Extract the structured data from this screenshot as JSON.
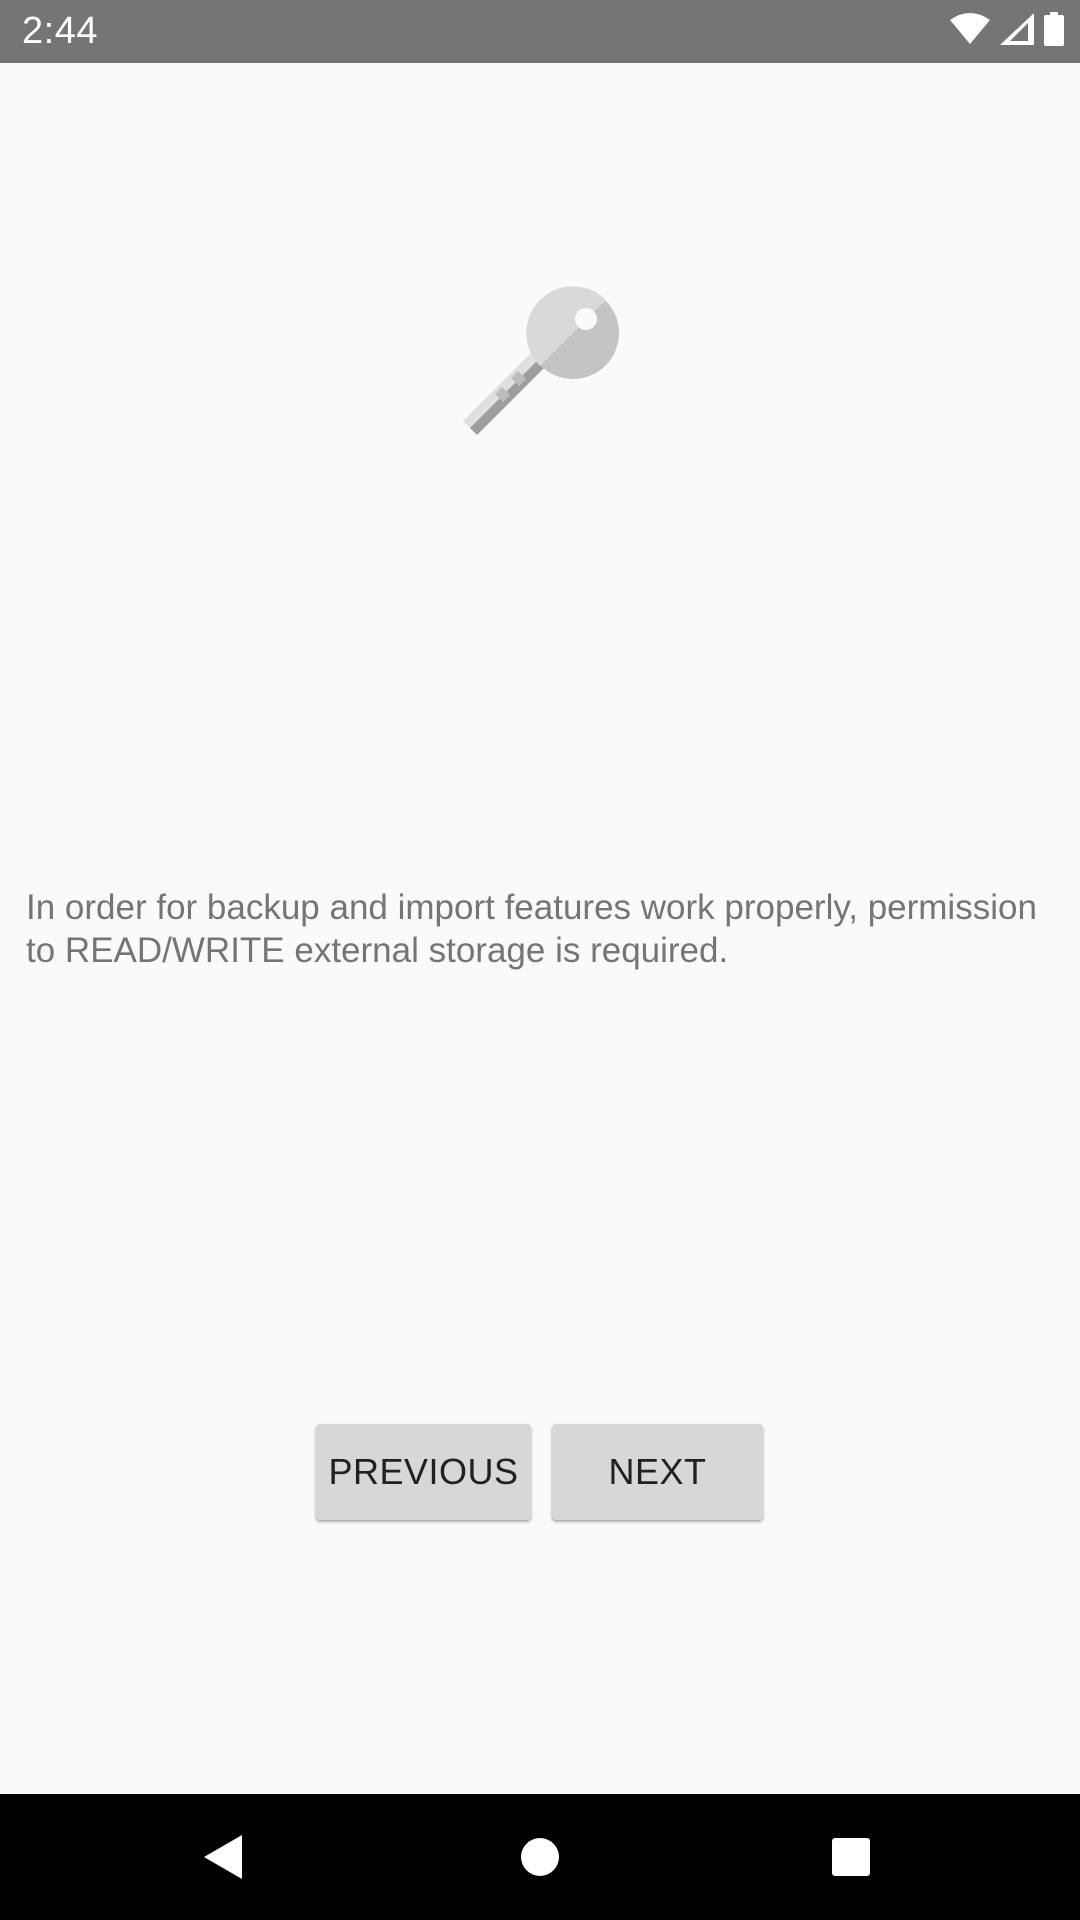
{
  "status_bar": {
    "time": "2:44",
    "icons": [
      "wifi-icon",
      "cellular-signal-icon",
      "battery-icon"
    ],
    "background": "#757575"
  },
  "main": {
    "icon": "key-icon",
    "message": "In order for backup and import features work properly, permission to READ/WRITE external storage is required.",
    "previous_label": "PREVIOUS",
    "next_label": "NEXT"
  },
  "nav_bar": {
    "icons": [
      "back-icon",
      "home-icon",
      "recents-icon"
    ]
  },
  "colors": {
    "background": "#fafafa",
    "text": "#757575",
    "button": "#d6d7d7",
    "button_text": "#212121"
  }
}
